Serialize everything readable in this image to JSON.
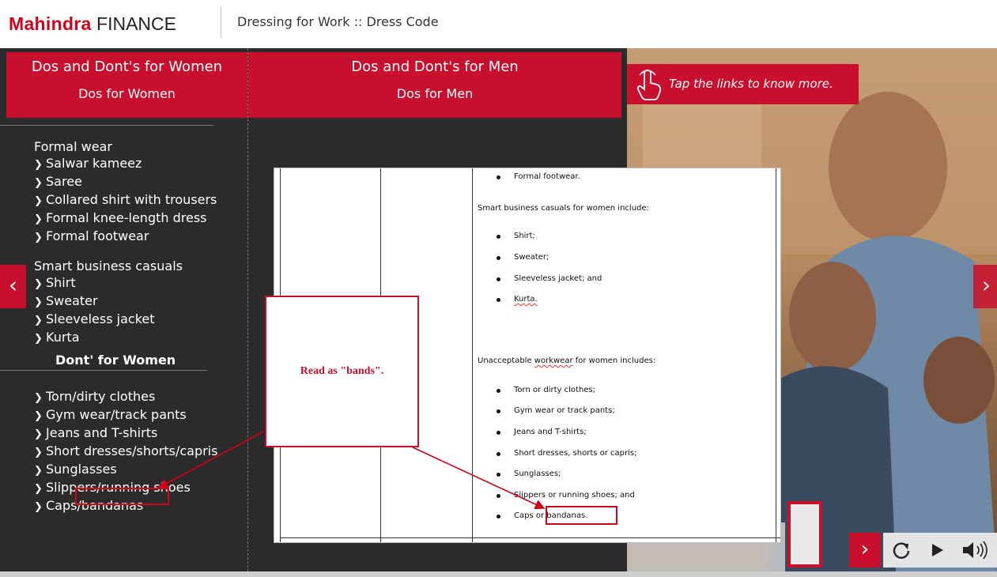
{
  "header": {
    "brand_part1": "Mahindra",
    "brand_part2": "FINANCE",
    "title": "Dressing for Work :: Dress Code"
  },
  "tabs": {
    "women": {
      "title": "Dos and Dont's for Women",
      "subtitle": "Dos for Women"
    },
    "men": {
      "title": "Dos and Dont's for Men",
      "subtitle": "Dos for Men"
    }
  },
  "tip": {
    "text": "Tap the links to know more.",
    "icon": "hand-tap-icon"
  },
  "women_dos": {
    "formal_heading": "Formal wear",
    "formal_items": [
      "Salwar kameez",
      "Saree",
      "Collared shirt with trousers",
      "Formal knee-length dress",
      "Formal footwear"
    ],
    "casual_heading": "Smart business casuals",
    "casual_items": [
      "Shirt",
      "Sweater",
      "Sleeveless jacket",
      "Kurta"
    ]
  },
  "women_donts": {
    "heading": "Dont' for Women",
    "items": [
      "Torn/dirty clothes",
      "Gym wear/track pants",
      "Jeans and T-shirts",
      "Short dresses/shorts/capris",
      "Sunglasses",
      "Slippers/running shoes",
      "Caps/bandanas"
    ]
  },
  "document": {
    "top_bullet": "Formal footwear.",
    "casual_intro": "Smart business casuals for women include:",
    "casual_items": [
      "Shirt;",
      "Sweater;",
      "Sleeveless jacket; and",
      "Kurta."
    ],
    "unacceptable_intro_a": "Unacceptable ",
    "unacceptable_intro_b": "workwear",
    "unacceptable_intro_c": " for women includes:",
    "unacceptable_items": [
      "Torn or dirty clothes;",
      "Gym wear or track pants;",
      "Jeans and T-shirts;",
      "Short dresses, shorts or capris;",
      "Sunglasses;",
      "Slippers or running shoes; and"
    ],
    "last_item_a": "Caps or ",
    "last_item_b": "bandanas."
  },
  "callout": {
    "text": "Read as \"bands\"."
  },
  "nav": {
    "prev_icon": "chevron-left-icon",
    "next_icon": "chevron-right-icon"
  },
  "controls": {
    "next": "chevron-right-icon",
    "replay": "replay-icon",
    "play": "play-icon",
    "audio": "speaker-icon"
  },
  "colors": {
    "accent": "#c8102e",
    "dark_bg": "#2b2b2b"
  }
}
